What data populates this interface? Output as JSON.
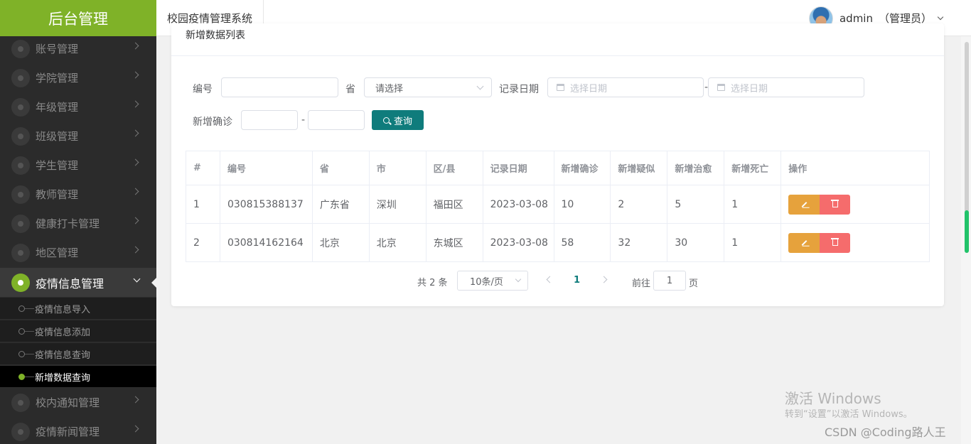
{
  "sidebar": {
    "brand": "后台管理",
    "menu": [
      {
        "label": "账号管理"
      },
      {
        "label": "学院管理"
      },
      {
        "label": "年级管理"
      },
      {
        "label": "班级管理"
      },
      {
        "label": "学生管理"
      },
      {
        "label": "教师管理"
      },
      {
        "label": "健康打卡管理"
      },
      {
        "label": "地区管理"
      },
      {
        "label": "疫情信息管理"
      },
      {
        "label": "校内通知管理"
      },
      {
        "label": "疫情新闻管理"
      }
    ],
    "active_menu": "疫情信息管理",
    "submenu": [
      {
        "label": "疫情信息导入"
      },
      {
        "label": "疫情信息添加"
      },
      {
        "label": "疫情信息查询"
      },
      {
        "label": "新增数据查询"
      }
    ],
    "active_submenu": "新增数据查询"
  },
  "header": {
    "tab": "校园疫情管理系统",
    "username": "admin",
    "role": "（管理员）"
  },
  "card": {
    "title": "新增数据列表"
  },
  "filters": {
    "code_label": "编号",
    "code_value": "",
    "province_label": "省",
    "province_placeholder": "请选择",
    "date_label": "记录日期",
    "date_start_placeholder": "选择日期",
    "date_end_placeholder": "选择日期",
    "date_separator": "-",
    "confirmed_label": "新增确诊",
    "confirmed_min": "",
    "confirmed_max": "",
    "confirmed_separator": "-",
    "query_button": "查询"
  },
  "table": {
    "headers": [
      "#",
      "编号",
      "省",
      "市",
      "区/县",
      "记录日期",
      "新增确诊",
      "新增疑似",
      "新增治愈",
      "新增死亡",
      "操作"
    ],
    "rows": [
      [
        "1",
        "030815388137",
        "广东省",
        "深圳",
        "福田区",
        "2023-03-08",
        "10",
        "2",
        "5",
        "1"
      ],
      [
        "2",
        "030814162164",
        "北京",
        "北京",
        "东城区",
        "2023-03-08",
        "58",
        "32",
        "30",
        "1"
      ]
    ]
  },
  "pagination": {
    "total": "共 2 条",
    "page_size": "10条/页",
    "current_page": "1",
    "goto_label": "前往",
    "goto_value": "1",
    "goto_suffix": "页"
  },
  "watermarks": {
    "activate_title": "激活 Windows",
    "activate_sub": "转到“设置”以激活 Windows。",
    "csdn": "CSDN @Coding路人王"
  },
  "colors": {
    "brand_green": "#7fb228",
    "sidebar_bg": "#2b2b2b",
    "primary_teal": "#0f7c7c",
    "edit_orange": "#e6a23c",
    "delete_red": "#f56c6c"
  }
}
